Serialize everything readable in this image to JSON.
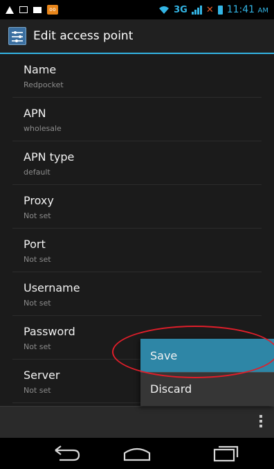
{
  "status_bar": {
    "network": "3G",
    "time": "11:41",
    "ampm": "AM",
    "notif_voicemail": "oo"
  },
  "action_bar": {
    "title": "Edit access point"
  },
  "settings": [
    {
      "title": "Name",
      "value": "Redpocket"
    },
    {
      "title": "APN",
      "value": "wholesale"
    },
    {
      "title": "APN type",
      "value": "default"
    },
    {
      "title": "Proxy",
      "value": "Not set"
    },
    {
      "title": "Port",
      "value": "Not set"
    },
    {
      "title": "Username",
      "value": "Not set"
    },
    {
      "title": "Password",
      "value": "Not set"
    },
    {
      "title": "Server",
      "value": "Not set"
    }
  ],
  "menu": {
    "save_label": "Save",
    "discard_label": "Discard"
  },
  "colors": {
    "accent": "#33b5e5",
    "highlight": "#2e86a6",
    "annotation": "#e01e2a"
  },
  "icons": [
    "warning-icon",
    "image-icon",
    "mail-icon",
    "voicemail-icon",
    "wifi-icon",
    "signal-icon",
    "battery-icon",
    "settings-app-icon",
    "overflow-menu-icon",
    "back-icon",
    "home-icon",
    "recent-apps-icon"
  ]
}
